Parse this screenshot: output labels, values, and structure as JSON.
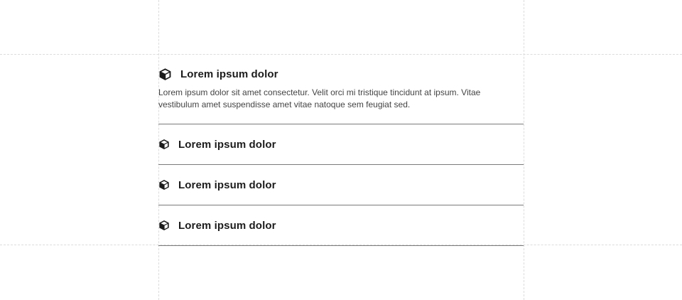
{
  "accordion": {
    "items": [
      {
        "title": "Lorem ipsum dolor",
        "icon": "box-icon",
        "expanded": true,
        "content": "Lorem ipsum dolor sit amet consectetur. Velit orci mi tristique tincidunt at ipsum. Vitae vestibulum amet suspendisse amet vitae natoque sem feugiat sed."
      },
      {
        "title": "Lorem ipsum dolor",
        "icon": "box-icon",
        "expanded": false
      },
      {
        "title": "Lorem ipsum dolor",
        "icon": "box-icon",
        "expanded": false
      },
      {
        "title": "Lorem ipsum dolor",
        "icon": "box-icon",
        "expanded": false
      }
    ]
  },
  "colors": {
    "divider": "#7a7a7a",
    "title": "#1c1c1c",
    "body_text": "#444444",
    "guides": "#dcdcdc"
  }
}
